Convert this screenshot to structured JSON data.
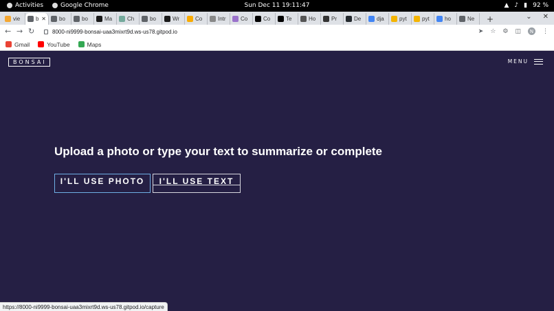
{
  "system": {
    "activities": "Activities",
    "app_name": "Google Chrome",
    "clock": "Sun Dec 11  19:11:47",
    "battery": "92 %"
  },
  "tabs": [
    {
      "label": "vie",
      "color": "#f4a732"
    },
    {
      "label": "b",
      "color": "#5f6368",
      "active": true
    },
    {
      "label": "bo",
      "color": "#5f6368"
    },
    {
      "label": "bo",
      "color": "#5f6368"
    },
    {
      "label": "Ma",
      "color": "#1a1a1a"
    },
    {
      "label": "Ch",
      "color": "#74aa9c"
    },
    {
      "label": "bo",
      "color": "#5f6368"
    },
    {
      "label": "Wr",
      "color": "#1a1a1a"
    },
    {
      "label": "Co",
      "color": "#f9ab00"
    },
    {
      "label": "Intr",
      "color": "#888888"
    },
    {
      "label": "Co",
      "color": "#9b72cb"
    },
    {
      "label": "Co",
      "color": "#000000"
    },
    {
      "label": "Te",
      "color": "#000000"
    },
    {
      "label": "Ho",
      "color": "#555555"
    },
    {
      "label": "Pr",
      "color": "#333333"
    },
    {
      "label": "De",
      "color": "#24292e"
    },
    {
      "label": "dja",
      "color": "#4285f4"
    },
    {
      "label": "pyt",
      "color": "#f4b400"
    },
    {
      "label": "pyt",
      "color": "#f4b400"
    },
    {
      "label": "ho",
      "color": "#4285f4"
    },
    {
      "label": "Ne",
      "color": "#5f6368"
    }
  ],
  "toolbar": {
    "url": "8000-ni9999-bonsai-uaa3mixrt9d.ws-us78.gitpod.io",
    "profile_initial": "N"
  },
  "bookmarks": [
    {
      "label": "Gmail",
      "color": "#ea4335"
    },
    {
      "label": "YouTube",
      "color": "#ff0000"
    },
    {
      "label": "Maps",
      "color": "#34a853"
    }
  ],
  "page": {
    "logo": "BONSAI",
    "menu_label": "MENU",
    "headline": "Upload a photo or type your text to summarize or complete",
    "photo_button": "I'LL USE PHOTO",
    "text_button": "I'LL USE TEXT",
    "accent_color": "#6fb0e6",
    "background_color": "#251f44"
  },
  "status_url": "https://8000-ni9999-bonsai-uaa3mixrt9d.ws-us78.gitpod.io/capture"
}
